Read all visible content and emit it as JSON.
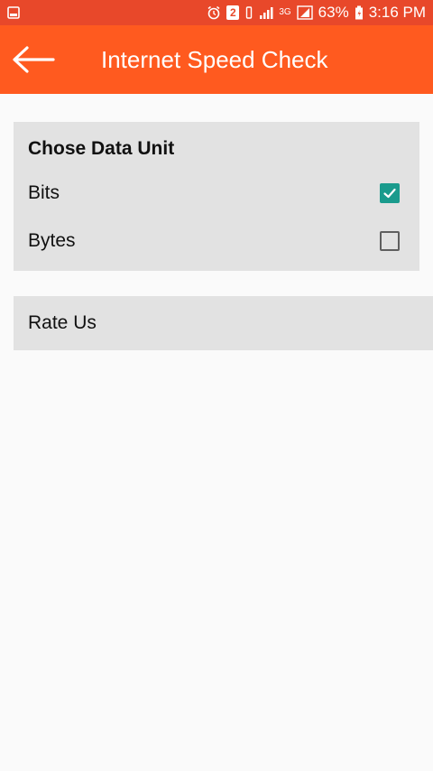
{
  "status_bar": {
    "battery_percent": "63%",
    "time": "3:16 PM",
    "network_label": "3G",
    "sim_label": "2",
    "color": "#e8482a"
  },
  "app_bar": {
    "title": "Internet Speed Check",
    "back_icon": "arrow-left-icon",
    "color": "#ff5a1f"
  },
  "data_unit": {
    "title": "Chose Data Unit",
    "options": [
      {
        "label": "Bits",
        "checked": true
      },
      {
        "label": "Bytes",
        "checked": false
      }
    ],
    "check_color": "#1a9b8d"
  },
  "rate_us": {
    "label": "Rate Us"
  }
}
